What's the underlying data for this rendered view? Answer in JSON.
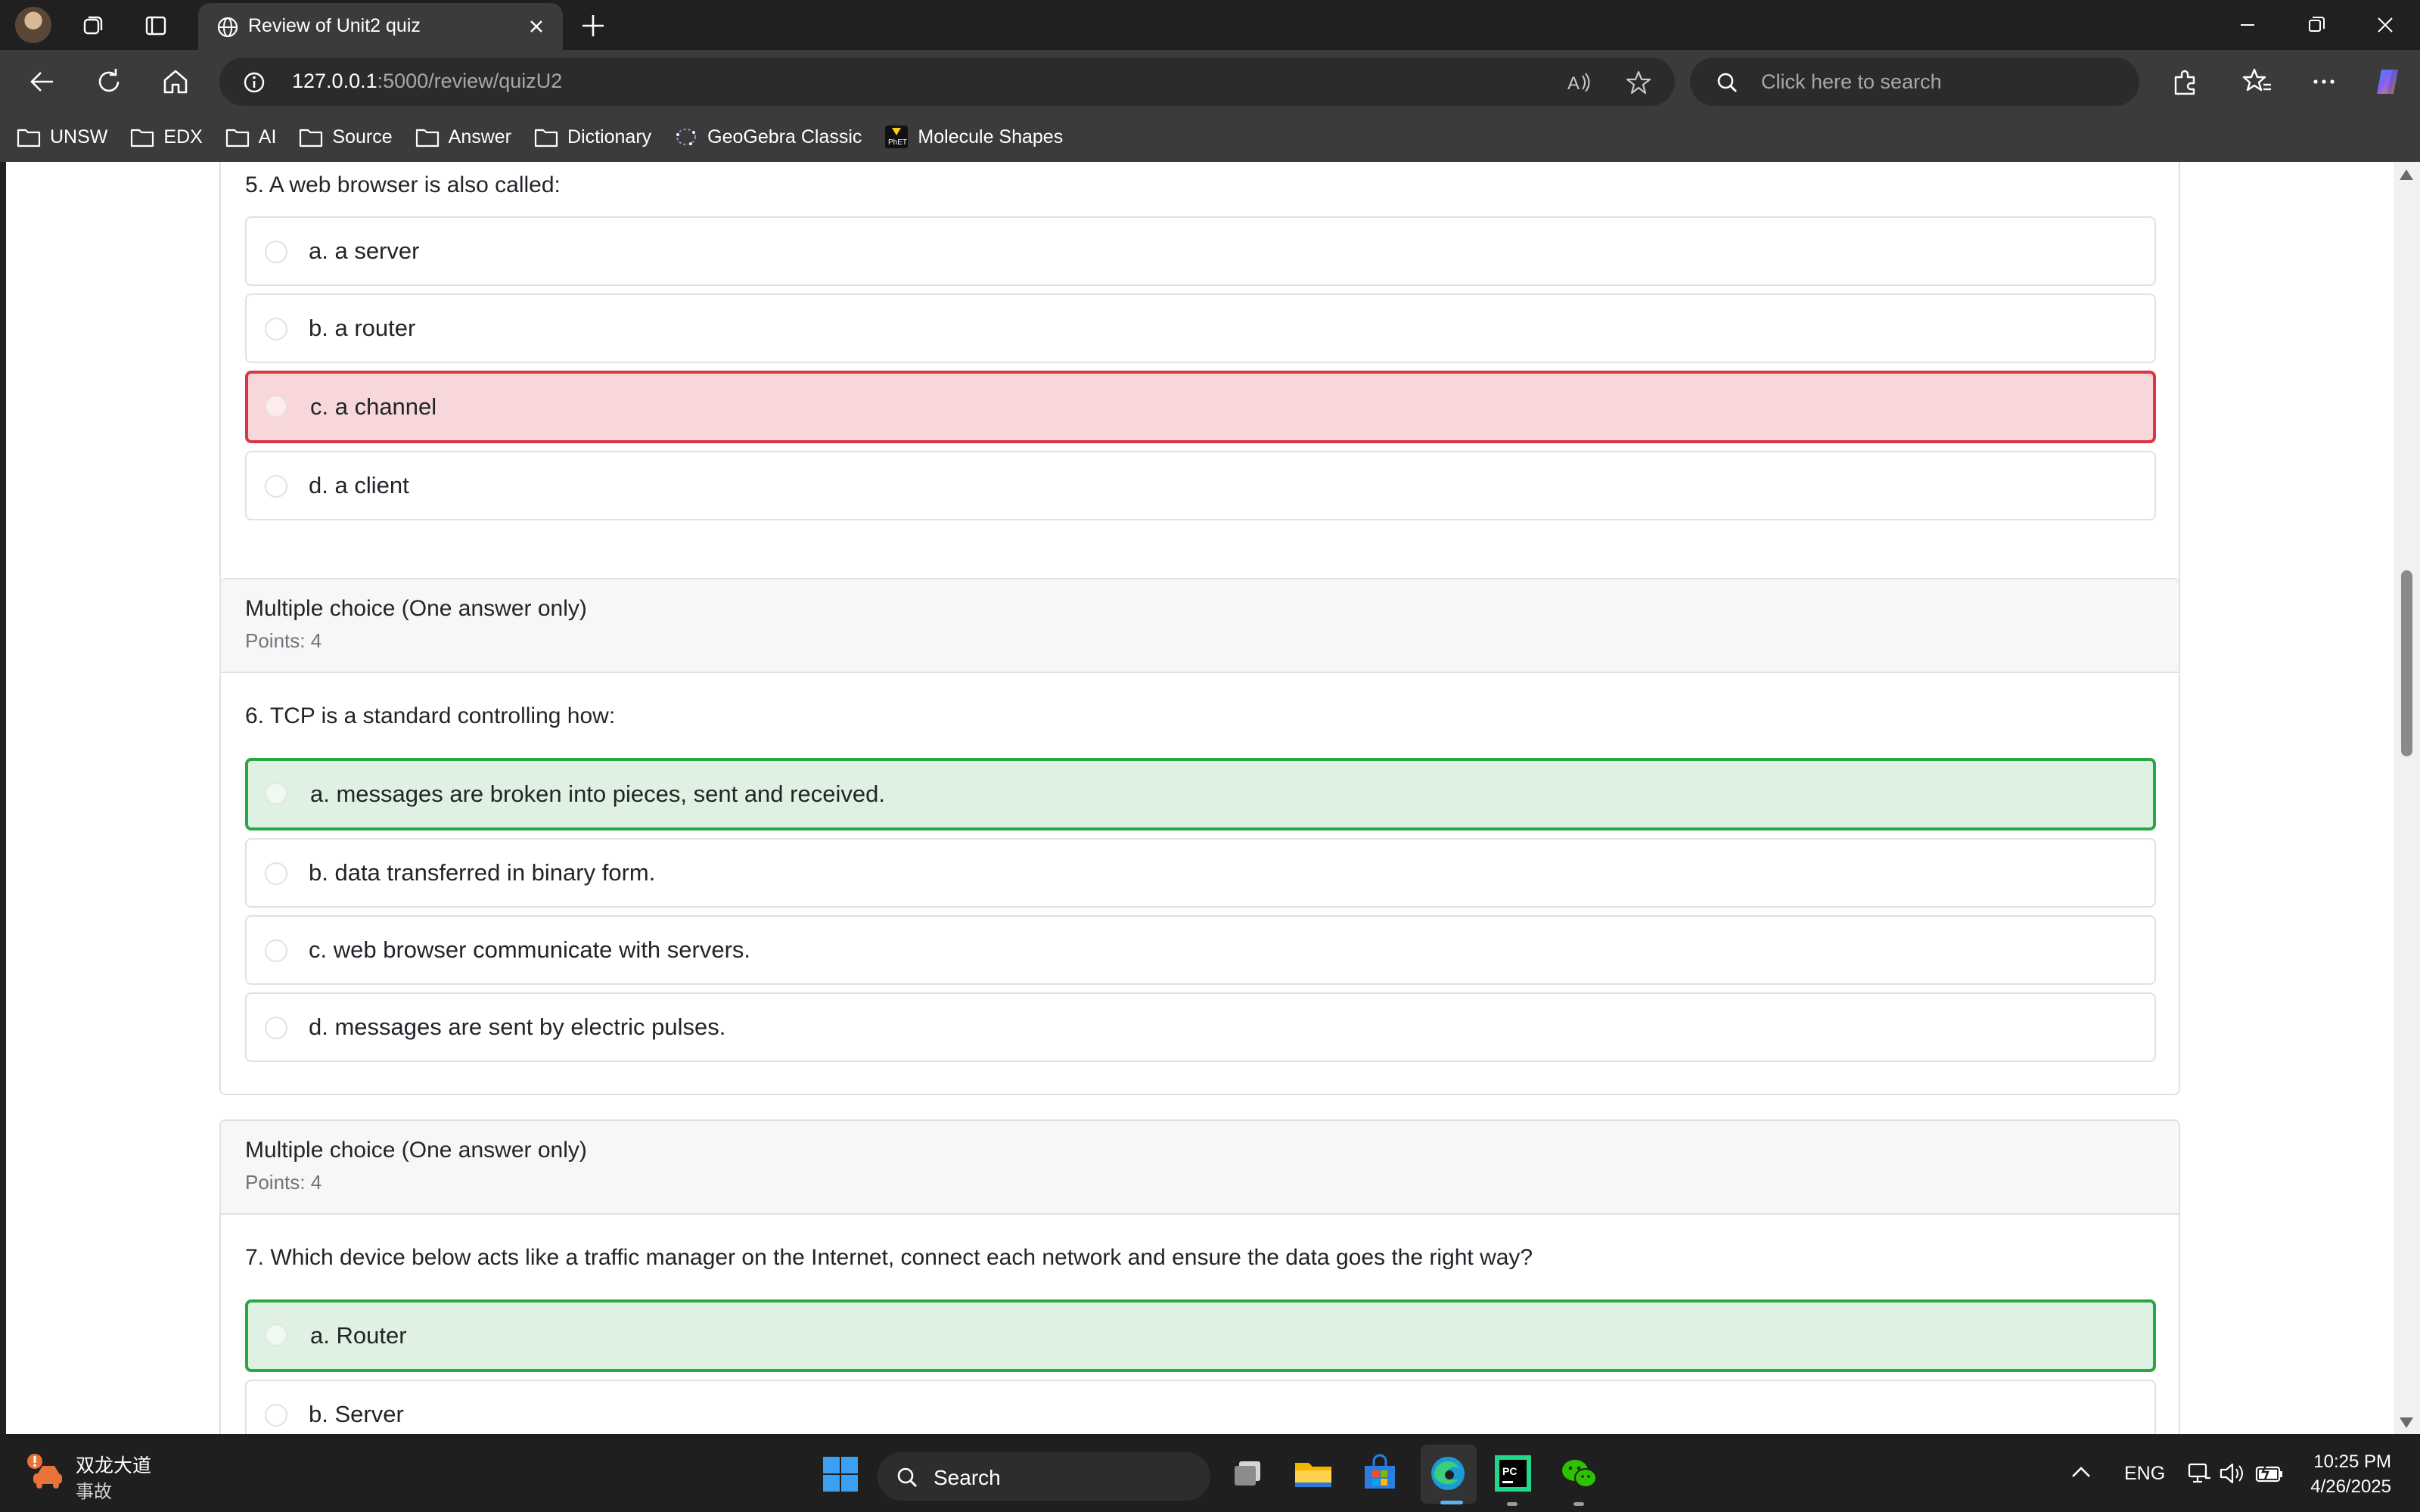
{
  "browser": {
    "tab_title": "Review of Unit2 quiz",
    "url_host": "127.0.0.1",
    "url_rest": ":5000/review/quizU2",
    "search_placeholder": "Click here to search"
  },
  "bookmarks": [
    {
      "label": "UNSW",
      "icon": "folder-icon"
    },
    {
      "label": "EDX",
      "icon": "folder-icon"
    },
    {
      "label": "AI",
      "icon": "folder-icon"
    },
    {
      "label": "Source",
      "icon": "folder-icon"
    },
    {
      "label": "Answer",
      "icon": "folder-icon"
    },
    {
      "label": "Dictionary",
      "icon": "folder-icon"
    },
    {
      "label": "GeoGebra Classic",
      "icon": "geogebra-icon"
    },
    {
      "label": "Molecule Shapes",
      "icon": "phet-icon"
    }
  ],
  "quiz": {
    "q5": {
      "question": "5. A web browser is also called:",
      "options": [
        {
          "label": "a. a server",
          "state": "neutral"
        },
        {
          "label": "b. a router",
          "state": "neutral"
        },
        {
          "label": "c. a channel",
          "state": "wrong"
        },
        {
          "label": "d. a client",
          "state": "neutral"
        }
      ]
    },
    "q6": {
      "type": "Multiple choice (One answer only)",
      "points": "Points: 4",
      "question": "6. TCP is a standard controlling how:",
      "options": [
        {
          "label": "a. messages are broken into pieces, sent and received.",
          "state": "correct"
        },
        {
          "label": "b. data transferred in binary form.",
          "state": "neutral"
        },
        {
          "label": "c. web browser communicate with servers.",
          "state": "neutral"
        },
        {
          "label": "d. messages are sent by electric pulses.",
          "state": "neutral"
        }
      ]
    },
    "q7": {
      "type": "Multiple choice (One answer only)",
      "points": "Points: 4",
      "question": "7. Which device below acts like a traffic manager on the Internet, connect each network and ensure the data goes the right way?",
      "options": [
        {
          "label": "a. Router",
          "state": "correct"
        },
        {
          "label": "b. Server",
          "state": "neutral"
        }
      ]
    }
  },
  "colors": {
    "wrong_bg": "#f8d7da",
    "wrong_border": "#dc3545",
    "correct_bg": "#dff1e2",
    "correct_border": "#28a745"
  },
  "taskbar": {
    "weather_title": "双龙大道",
    "weather_sub": "事故",
    "search_label": "Search",
    "language": "ENG",
    "time": "10:25 PM",
    "date": "4/26/2025"
  }
}
